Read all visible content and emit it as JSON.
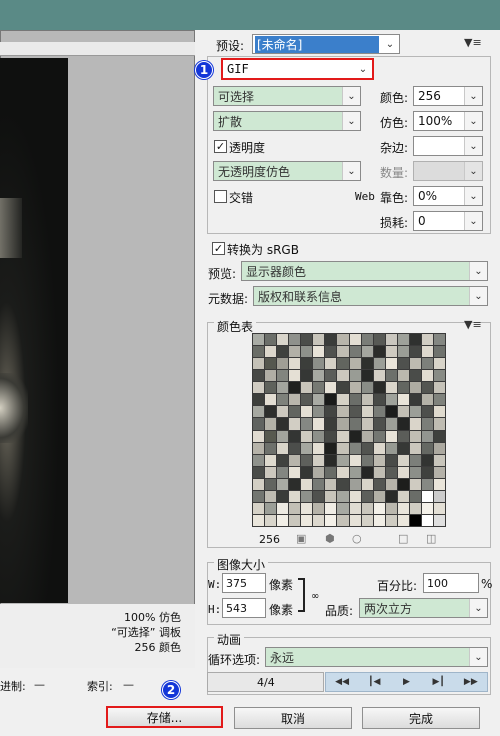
{
  "preset": {
    "label": "预设:",
    "value": "[未命名]"
  },
  "format": {
    "value": "GIF"
  },
  "reduction": {
    "value": "可选择"
  },
  "colors": {
    "label": "颜色:",
    "value": "256"
  },
  "dither_algo": {
    "value": "扩散"
  },
  "dither": {
    "label": "仿色:",
    "value": "100%"
  },
  "transparency": {
    "label": "透明度",
    "checked": true
  },
  "matte": {
    "label": "杂边:",
    "value": ""
  },
  "transparency_dither": {
    "value": "无透明度仿色"
  },
  "amount": {
    "label": "数量:",
    "value": ""
  },
  "interlaced": {
    "label": "交错",
    "checked": false
  },
  "web_snap": {
    "label_web": "Web",
    "label": "靠色:",
    "value": "0%"
  },
  "lossy": {
    "label": "损耗:",
    "value": "0"
  },
  "convert_srgb": {
    "label": "转换为 sRGB",
    "checked": true
  },
  "preview_row": {
    "label": "预览:",
    "value": "显示器颜色"
  },
  "metadata": {
    "label": "元数据:",
    "value": "版权和联系信息"
  },
  "color_table": {
    "title": "颜色表",
    "count": "256"
  },
  "image_size": {
    "title": "图像大小",
    "w_label": "W:",
    "w_value": "375",
    "w_unit": "像素",
    "h_label": "H:",
    "h_value": "543",
    "h_unit": "像素",
    "percent_label": "百分比:",
    "percent_value": "100",
    "percent_unit": "%",
    "quality_label": "品质:",
    "quality_value": "两次立方"
  },
  "animation": {
    "title": "动画",
    "loop_label": "循环选项:",
    "loop_value": "永远",
    "frame": "4/4"
  },
  "info": {
    "line1": "100% 仿色",
    "line2": "“可选择” 调板",
    "line3": "256 颜色"
  },
  "status": {
    "hex_label": "进制:",
    "hex_value": "—",
    "index_label": "索引:",
    "index_value": "—"
  },
  "buttons": {
    "save": "存储...",
    "cancel": "取消",
    "done": "完成"
  },
  "badges": {
    "one": "1",
    "two": "2"
  },
  "swatches": [
    "#a9aca5",
    "#6c6f6a",
    "#d9d5cb",
    "#8f918c",
    "#4b4d4a",
    "#c7c4ba",
    "#3a3c3a",
    "#b8b5ab",
    "#e3ded3",
    "#7a7d78",
    "#575955",
    "#cac7bf",
    "#9ea19a",
    "#2f312f",
    "#d1cdc3",
    "#848782",
    "#6a6d67",
    "#dcd7cc",
    "#3f413e",
    "#b2b0a7",
    "#8e918b",
    "#e8e3d8",
    "#50524f",
    "#c0bdb3",
    "#767974",
    "#a4a69f",
    "#2b2c2a",
    "#cfcbc1",
    "#9a9d96",
    "#454744",
    "#ded9ce",
    "#6f726d",
    "#c4c1b7",
    "#55574f",
    "#a09e95",
    "#e0dbd0",
    "#3c3e3b",
    "#8c8f89",
    "#d6d2c7",
    "#62655f",
    "#b5b3a9",
    "#2e302d",
    "#9b9e97",
    "#eae5da",
    "#4f514e",
    "#bebbb1",
    "#7d807b",
    "#d8d4c9",
    "#474946",
    "#b0aea5",
    "#82857f",
    "#e5e0d5",
    "#353735",
    "#a7a9a2",
    "#5c5e5a",
    "#ccc8be",
    "#999c95",
    "#272927",
    "#d3cfc5",
    "#6d706b",
    "#bbb8ae",
    "#4a4c49",
    "#e1dcd1",
    "#888b85",
    "#d0ccc2",
    "#5f625c",
    "#a3a59e",
    "#1f201e",
    "#c9c5bb",
    "#767973",
    "#e7e2d7",
    "#414340",
    "#b7b4aa",
    "#8a8d87",
    "#2a2b29",
    "#dbd6cb",
    "#636661",
    "#aeaca2",
    "#535551",
    "#c6c3b9",
    "#3d3f3c",
    "#e2ddd2",
    "#7e817b",
    "#b9b6ac",
    "#585a56",
    "#a8aaa3",
    "#1a1b1a",
    "#d5d1c6",
    "#6b6e69",
    "#c2bfb5",
    "#484a47",
    "#9fa29b",
    "#e9e4d9",
    "#383a38",
    "#b4b2a8",
    "#7f827c",
    "#a6a8a1",
    "#2d2e2c",
    "#cdc9bf",
    "#626560",
    "#e4dfd4",
    "#8b8e88",
    "#434542",
    "#bcb9af",
    "#545652",
    "#d7d3c8",
    "#797c77",
    "#1c1d1c",
    "#c3c0b6",
    "#9c9f98",
    "#4d4f4c",
    "#dfdace",
    "#606360",
    "#b3b1a7",
    "#2f302e",
    "#d2cec4",
    "#858883",
    "#e6e1d6",
    "#3b3d3a",
    "#aaa9a0",
    "#70736e",
    "#c8c4ba",
    "#4e504d",
    "#9d9f98",
    "#242524",
    "#dad5ca",
    "#7b7e79",
    "#bfbcb2",
    "#e0dbd0",
    "#57594f",
    "#a2a49d",
    "#333533",
    "#cecac0",
    "#8d908a",
    "#464845",
    "#d4d0c5",
    "#212220",
    "#b1afa6",
    "#747772",
    "#e8e3d8",
    "#5b5d59",
    "#c1beb4",
    "#929590",
    "#3e403d",
    "#b6b3a9",
    "#6e716c",
    "#d9d5ca",
    "#4c4e4b",
    "#a5a7a0",
    "#e3ded3",
    "#1e1f1d",
    "#c5c2b8",
    "#81847e",
    "#525450",
    "#dcd7cc",
    "#979a93",
    "#363836",
    "#cbc7bd",
    "#656863",
    "#aca9a0",
    "#8f928c",
    "#dedace",
    "#40423f",
    "#b8b5ab",
    "#5e605c",
    "#d1cdc3",
    "#292a28",
    "#a1a39c",
    "#e5e0d5",
    "#727570",
    "#bdbab0",
    "#494b48",
    "#d6d2c7",
    "#7c7f7a",
    "#323432",
    "#c8c5bb",
    "#4a4c49",
    "#ccc8be",
    "#838681",
    "#e7e2d7",
    "#353735",
    "#aeaca3",
    "#686b66",
    "#dbd6cb",
    "#9a9d96",
    "#252625",
    "#c0bdb3",
    "#595b57",
    "#e2ddd2",
    "#8c8f89",
    "#3f413e",
    "#b4b1a8",
    "#d3cfc4",
    "#626560",
    "#a9aba4",
    "#2c2d2b",
    "#e1dcd1",
    "#777a75",
    "#c4c1b7",
    "#444643",
    "#9e9f99",
    "#d8d4c9",
    "#545652",
    "#b7b4aa",
    "#1d1e1c",
    "#cfcbc1",
    "#868984",
    "#eae5da",
    "#737671",
    "#bfbcb2",
    "#3a3c39",
    "#dcd8cd",
    "#8e918b",
    "#4f514e",
    "#c7c4ba",
    "#a4a69f",
    "#e4dfd4",
    "#5d5f5b",
    "#b2b0a6",
    "#2a2b29",
    "#d5d1c6",
    "#6a6d68",
    "#ffffff",
    "#cccccc",
    "#d6d2c7",
    "#9b9e97",
    "#edeae2",
    "#c2bfb5",
    "#e8e4da",
    "#b6b3a9",
    "#f0ede5",
    "#a7a9a2",
    "#e0dcd2",
    "#c9c6bc",
    "#f3f0e8",
    "#bbb8ae",
    "#e9e5db",
    "#d0cdc3",
    "#f5f2ea",
    "#e4e0d6",
    "#eae6dc",
    "#d8d5cb",
    "#f2efe7",
    "#cac7bd",
    "#ece8de",
    "#ddd9cf",
    "#f4f1e9",
    "#c5c2b8",
    "#e6e2d8",
    "#d4d1c7",
    "#f1eee6",
    "#cfccc2",
    "#ebe7dd",
    "#000000",
    "#ffffff",
    "#e0e0e0"
  ]
}
